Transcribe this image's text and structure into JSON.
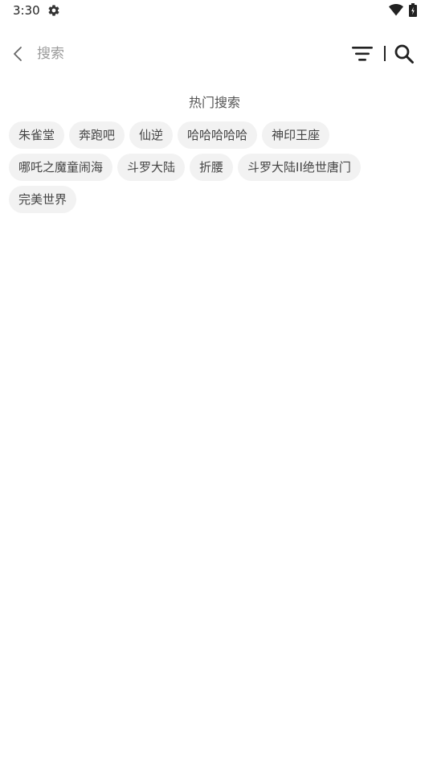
{
  "status_bar": {
    "time": "3:30",
    "icons": [
      "gear-icon",
      "wifi-icon",
      "battery-icon"
    ]
  },
  "search_bar": {
    "back_icon": "chevron-left-icon",
    "placeholder": "搜索",
    "value": "",
    "filter_icon": "filter-icon",
    "search_icon": "search-icon"
  },
  "hot_search": {
    "title": "热门搜索",
    "rows": [
      [
        "朱雀堂",
        "奔跑吧",
        "仙逆",
        "哈哈哈哈哈",
        "神印王座"
      ],
      [
        "哪吒之魔童闹海",
        "斗罗大陆",
        "折腰",
        "斗罗大陆II绝世唐门"
      ],
      [
        "完美世界"
      ]
    ]
  },
  "colors": {
    "background": "#ffffff",
    "tag_background": "#f2f2f2",
    "text": "#444444",
    "placeholder": "#9a9a9a"
  }
}
